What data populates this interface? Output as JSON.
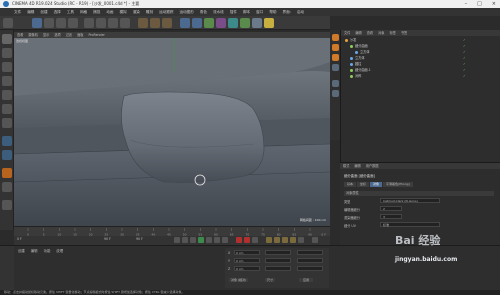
{
  "window": {
    "title": "CINEMA 4D R19.024 Studio (RC - R19) - [沙发_0001.c4d *] - 主要"
  },
  "menu": [
    "文件",
    "编辑",
    "创建",
    "选择",
    "工具",
    "网格",
    "捕捉",
    "动画",
    "模拟",
    "渲染",
    "雕刻",
    "运动跟踪",
    "运动图形",
    "角色",
    "流水线",
    "插件",
    "脚本",
    "窗口",
    "帮助",
    "界面:",
    "启动"
  ],
  "viewport": {
    "menu": [
      "查看",
      "摄像机",
      "显示",
      "选项",
      "过滤",
      "面板",
      "ProRender"
    ],
    "label": "透视视图",
    "grid": "网格间距 : 100 cm"
  },
  "timeline": {
    "ticks": [
      "0",
      "5",
      "10",
      "15",
      "20",
      "25",
      "30",
      "35",
      "40",
      "45",
      "50",
      "55",
      "60",
      "65",
      "70",
      "75",
      "80",
      "85",
      "90"
    ],
    "end": "0 F"
  },
  "transport": {
    "start": "0 F",
    "current": "0 F",
    "end": "90 F",
    "end2": "90 F"
  },
  "materials": {
    "tabs": [
      "创建",
      "编辑",
      "功能",
      "纹理"
    ]
  },
  "coords": {
    "rows": [
      "X",
      "Y",
      "Z"
    ],
    "values": [
      "0 cm",
      "0 cm",
      "0 cm"
    ],
    "buttons": [
      "对象 (相对)",
      "尺寸",
      "应用"
    ]
  },
  "objects": {
    "menu": [
      "文件",
      "编辑",
      "查看",
      "对象",
      "标签",
      "书签"
    ],
    "items": [
      {
        "name": "沙发",
        "indent": 0,
        "color": "#e8a23c"
      },
      {
        "name": "细分曲面",
        "indent": 1,
        "color": "#8ecf5b"
      },
      {
        "name": "立方体",
        "indent": 2,
        "color": "#6aa8e8"
      },
      {
        "name": "立方体",
        "indent": 1,
        "color": "#6aa8e8"
      },
      {
        "name": "圆柱",
        "indent": 1,
        "color": "#6aa8e8"
      },
      {
        "name": "细分曲面.1",
        "indent": 1,
        "color": "#8ecf5b"
      },
      {
        "name": "对称",
        "indent": 1,
        "color": "#8ecf5b"
      }
    ]
  },
  "attributes": {
    "menu": [
      "模式",
      "编辑",
      "用户数据"
    ],
    "title": "细分曲面 [细分曲面]",
    "tabs": [
      "基本",
      "坐标",
      "对象",
      "平滑着色(Phong)"
    ],
    "section": "对象属性",
    "rows": [
      {
        "label": "类型",
        "value": "Catmull-Clark (N-Gons)"
      },
      {
        "label": "编辑器细分",
        "value": "2"
      },
      {
        "label": "渲染器细分",
        "value": "3"
      },
      {
        "label": "细分 UV",
        "value": "标准"
      }
    ]
  },
  "status": "移动：点击并拖动鼠标移动元素。按住 SHIFT 键量化移动；节点编辑模式时按住 SHIFT 键增加选择对象；按住 CTRL 键减少选择对象。",
  "watermark": {
    "brand": "Bai 经验",
    "site": "jingyan.baidu.com"
  }
}
